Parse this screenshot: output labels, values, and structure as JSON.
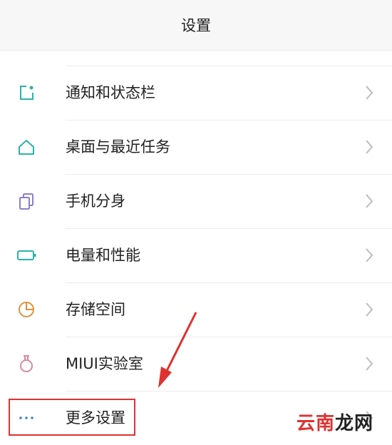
{
  "header": {
    "title": "设置"
  },
  "items": [
    {
      "label": "通知和状态栏"
    },
    {
      "label": "桌面与最近任务"
    },
    {
      "label": "手机分身"
    },
    {
      "label": "电量和性能"
    },
    {
      "label": "存储空间"
    },
    {
      "label": "MIUI实验室"
    },
    {
      "label": "更多设置"
    }
  ],
  "watermark": {
    "text_red": "云南",
    "text_dark": "龙网"
  },
  "colors": {
    "icon_teal": "#2bb3a6",
    "icon_purple": "#8b7fc7",
    "icon_orange": "#e0923e",
    "icon_pink": "#d98a9e",
    "icon_blue": "#3a86c8",
    "highlight_red": "#e03131"
  }
}
